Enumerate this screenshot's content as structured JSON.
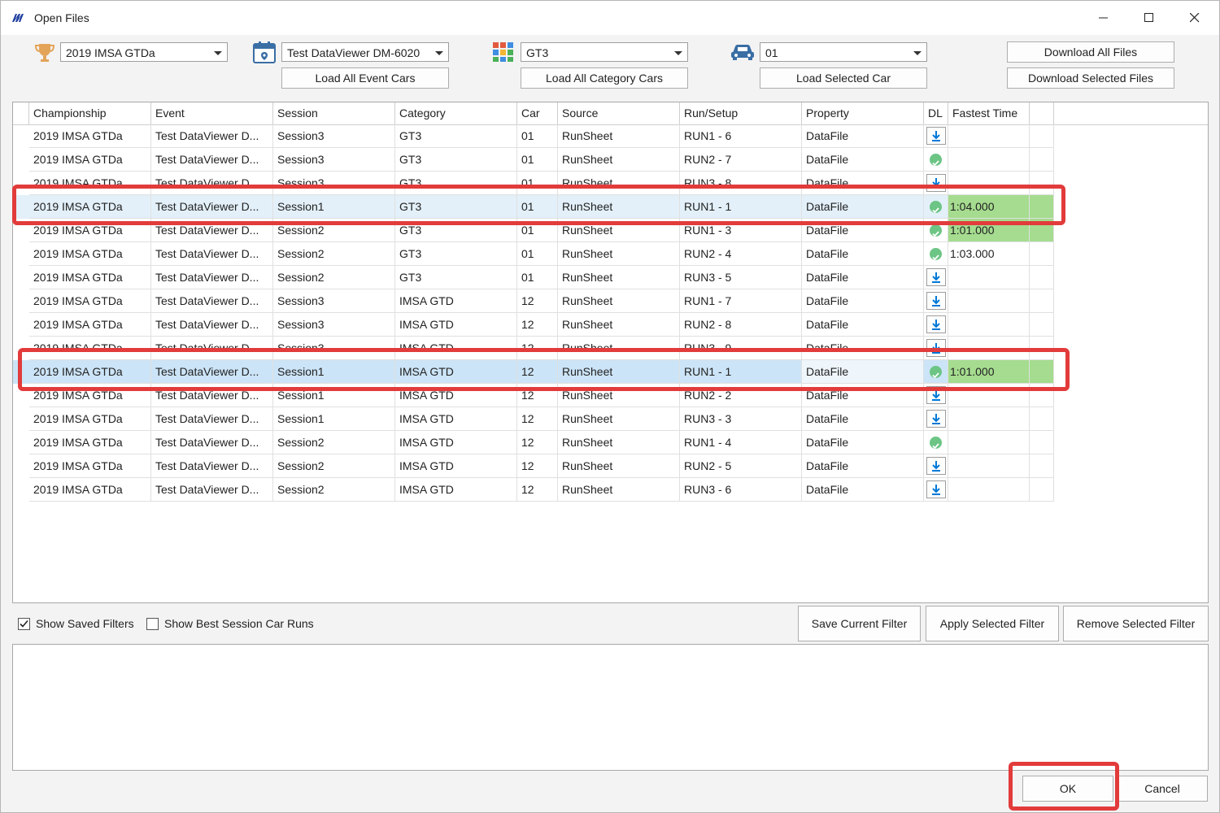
{
  "window": {
    "title": "Open Files",
    "minimize_label": "—",
    "maximize_label": "☐",
    "close_label": "✕"
  },
  "filters": {
    "championship": {
      "icon": "trophy-icon",
      "value": "2019 IMSA GTDa"
    },
    "event": {
      "icon": "calendar-icon",
      "value": "Test DataViewer DM-6020",
      "load_label": "Load All Event Cars"
    },
    "category": {
      "icon": "category-grid-icon",
      "value": "GT3",
      "load_label": "Load All Category Cars"
    },
    "car": {
      "icon": "car-icon",
      "value": "01",
      "load_label": "Load Selected Car"
    },
    "download_all_label": "Download All Files",
    "download_selected_label": "Download Selected Files"
  },
  "grid": {
    "columns": [
      "Championship",
      "Event",
      "Session",
      "Category",
      "Car",
      "Source",
      "Run/Setup",
      "Property",
      "DL",
      "Fastest Time"
    ],
    "rows": [
      {
        "championship": "2019 IMSA GTDa",
        "event": "Test DataViewer D...",
        "session": "Session3",
        "category": "GT3",
        "car": "01",
        "source": "RunSheet",
        "run": "RUN1 - 6",
        "property": "DataFile",
        "dl": "download",
        "fastest": "",
        "fast_fill": false,
        "selected": false
      },
      {
        "championship": "2019 IMSA GTDa",
        "event": "Test DataViewer D...",
        "session": "Session3",
        "category": "GT3",
        "car": "01",
        "source": "RunSheet",
        "run": "RUN2 - 7",
        "property": "DataFile",
        "dl": "done",
        "fastest": "",
        "fast_fill": false,
        "selected": false
      },
      {
        "championship": "2019 IMSA GTDa",
        "event": "Test DataViewer D...",
        "session": "Session3",
        "category": "GT3",
        "car": "01",
        "source": "RunSheet",
        "run": "RUN3 - 8",
        "property": "DataFile",
        "dl": "download",
        "fastest": "",
        "fast_fill": false,
        "selected": false
      },
      {
        "championship": "2019 IMSA GTDa",
        "event": "Test DataViewer D...",
        "session": "Session1",
        "category": "GT3",
        "car": "01",
        "source": "RunSheet",
        "run": "RUN1 - 1",
        "property": "DataFile",
        "dl": "done",
        "fastest": "1:04.000",
        "fast_fill": true,
        "selected": true
      },
      {
        "championship": "2019 IMSA GTDa",
        "event": "Test DataViewer D...",
        "session": "Session2",
        "category": "GT3",
        "car": "01",
        "source": "RunSheet",
        "run": "RUN1 - 3",
        "property": "DataFile",
        "dl": "done",
        "fastest": "1:01.000",
        "fast_fill": true,
        "selected": false
      },
      {
        "championship": "2019 IMSA GTDa",
        "event": "Test DataViewer D...",
        "session": "Session2",
        "category": "GT3",
        "car": "01",
        "source": "RunSheet",
        "run": "RUN2 - 4",
        "property": "DataFile",
        "dl": "done",
        "fastest": "1:03.000",
        "fast_fill": false,
        "selected": false
      },
      {
        "championship": "2019 IMSA GTDa",
        "event": "Test DataViewer D...",
        "session": "Session2",
        "category": "GT3",
        "car": "01",
        "source": "RunSheet",
        "run": "RUN3 - 5",
        "property": "DataFile",
        "dl": "download",
        "fastest": "",
        "fast_fill": false,
        "selected": false
      },
      {
        "championship": "2019 IMSA GTDa",
        "event": "Test DataViewer D...",
        "session": "Session3",
        "category": "IMSA GTD",
        "car": "12",
        "source": "RunSheet",
        "run": "RUN1 - 7",
        "property": "DataFile",
        "dl": "download",
        "fastest": "",
        "fast_fill": false,
        "selected": false
      },
      {
        "championship": "2019 IMSA GTDa",
        "event": "Test DataViewer D...",
        "session": "Session3",
        "category": "IMSA GTD",
        "car": "12",
        "source": "RunSheet",
        "run": "RUN2 - 8",
        "property": "DataFile",
        "dl": "download",
        "fastest": "",
        "fast_fill": false,
        "selected": false
      },
      {
        "championship": "2019 IMSA GTDa",
        "event": "Test DataViewer D...",
        "session": "Session3",
        "category": "IMSA GTD",
        "car": "12",
        "source": "RunSheet",
        "run": "RUN3 - 9",
        "property": "DataFile",
        "dl": "download",
        "fastest": "",
        "fast_fill": false,
        "selected": false
      },
      {
        "championship": "2019 IMSA GTDa",
        "event": "Test DataViewer D...",
        "session": "Session1",
        "category": "IMSA GTD",
        "car": "12",
        "source": "RunSheet",
        "run": "RUN1 - 1",
        "property": "DataFile",
        "dl": "done",
        "fastest": "1:01.000",
        "fast_fill": true,
        "selected": true
      },
      {
        "championship": "2019 IMSA GTDa",
        "event": "Test DataViewer D...",
        "session": "Session1",
        "category": "IMSA GTD",
        "car": "12",
        "source": "RunSheet",
        "run": "RUN2 - 2",
        "property": "DataFile",
        "dl": "download",
        "fastest": "",
        "fast_fill": false,
        "selected": false
      },
      {
        "championship": "2019 IMSA GTDa",
        "event": "Test DataViewer D...",
        "session": "Session1",
        "category": "IMSA GTD",
        "car": "12",
        "source": "RunSheet",
        "run": "RUN3 - 3",
        "property": "DataFile",
        "dl": "download",
        "fastest": "",
        "fast_fill": false,
        "selected": false
      },
      {
        "championship": "2019 IMSA GTDa",
        "event": "Test DataViewer D...",
        "session": "Session2",
        "category": "IMSA GTD",
        "car": "12",
        "source": "RunSheet",
        "run": "RUN1 - 4",
        "property": "DataFile",
        "dl": "done",
        "fastest": "",
        "fast_fill": false,
        "selected": false
      },
      {
        "championship": "2019 IMSA GTDa",
        "event": "Test DataViewer D...",
        "session": "Session2",
        "category": "IMSA GTD",
        "car": "12",
        "source": "RunSheet",
        "run": "RUN2 - 5",
        "property": "DataFile",
        "dl": "download",
        "fastest": "",
        "fast_fill": false,
        "selected": false
      },
      {
        "championship": "2019 IMSA GTDa",
        "event": "Test DataViewer D...",
        "session": "Session2",
        "category": "IMSA GTD",
        "car": "12",
        "source": "RunSheet",
        "run": "RUN3 - 6",
        "property": "DataFile",
        "dl": "download",
        "fastest": "",
        "fast_fill": false,
        "selected": false
      }
    ]
  },
  "saved_filters": {
    "show_saved_label": "Show Saved Filters",
    "show_saved_checked": true,
    "show_best_label": "Show Best Session Car Runs",
    "show_best_checked": false,
    "save_label": "Save Current Filter",
    "apply_label": "Apply Selected Filter",
    "remove_label": "Remove Selected Filter"
  },
  "footer": {
    "ok_label": "OK",
    "cancel_label": "Cancel"
  },
  "colors": {
    "accent": "#0078d7",
    "highlight": "#e23b3b",
    "fast_fill": "#a5dc8f",
    "selected_row": "#cce4f7",
    "done": "#6cc585"
  }
}
